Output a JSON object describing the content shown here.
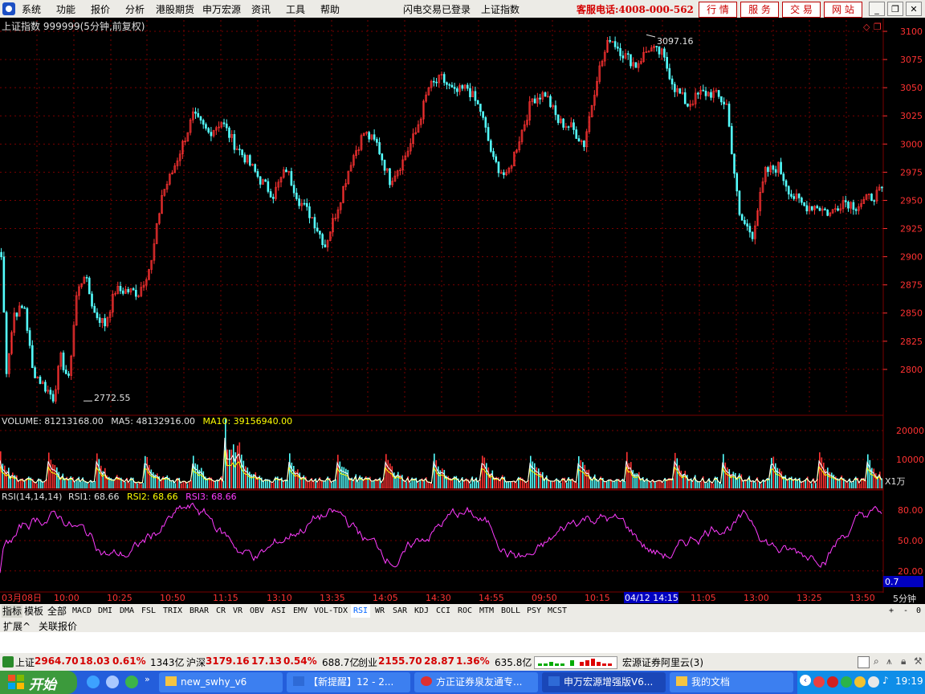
{
  "menu": {
    "items": [
      "系统",
      "功能",
      "报价",
      "分析",
      "港股期货",
      "申万宏源",
      "资讯",
      "工具",
      "帮助"
    ],
    "status_text": "闪电交易已登录",
    "index_name": "上证指数",
    "hotline": "客服电话:4008-000-562",
    "buttons": [
      "行 情",
      "服 务",
      "交 易",
      "网 站"
    ]
  },
  "chart_data": [
    {
      "type": "candlestick",
      "title": "上证指数 999999(5分钟,前复权)",
      "ylim": [
        2760,
        3110
      ],
      "yticks": [
        2800,
        2825,
        2850,
        2875,
        2900,
        2925,
        2950,
        2975,
        3000,
        3025,
        3050,
        3075,
        3100
      ],
      "keypoints": [
        [
          0,
          2900
        ],
        [
          2,
          2800
        ],
        [
          5,
          2850
        ],
        [
          9,
          2855
        ],
        [
          12,
          2800
        ],
        [
          15,
          2790
        ],
        [
          20,
          2775
        ],
        [
          23,
          2810
        ],
        [
          26,
          2790
        ],
        [
          29,
          2865
        ],
        [
          32,
          2885
        ],
        [
          36,
          2850
        ],
        [
          40,
          2840
        ],
        [
          44,
          2870
        ],
        [
          48,
          2870
        ],
        [
          53,
          2868
        ],
        [
          58,
          2895
        ],
        [
          62,
          2955
        ],
        [
          66,
          2975
        ],
        [
          70,
          3000
        ],
        [
          74,
          3025
        ],
        [
          80,
          3010
        ],
        [
          85,
          3020
        ],
        [
          90,
          3000
        ],
        [
          95,
          2985
        ],
        [
          100,
          2968
        ],
        [
          105,
          2955
        ],
        [
          110,
          2978
        ],
        [
          115,
          2950
        ],
        [
          120,
          2935
        ],
        [
          125,
          2910
        ],
        [
          130,
          2945
        ],
        [
          135,
          2985
        ],
        [
          140,
          3010
        ],
        [
          145,
          3000
        ],
        [
          150,
          2968
        ],
        [
          155,
          2985
        ],
        [
          160,
          3010
        ],
        [
          165,
          3050
        ],
        [
          170,
          3058
        ],
        [
          175,
          3045
        ],
        [
          180,
          3050
        ],
        [
          185,
          3030
        ],
        [
          190,
          2985
        ],
        [
          195,
          2970
        ],
        [
          200,
          3005
        ],
        [
          205,
          3040
        ],
        [
          210,
          3045
        ],
        [
          215,
          3020
        ],
        [
          220,
          3015
        ],
        [
          225,
          3000
        ],
        [
          230,
          3060
        ],
        [
          235,
          3095
        ],
        [
          240,
          3080
        ],
        [
          245,
          3070
        ],
        [
          250,
          3085
        ],
        [
          255,
          3080
        ],
        [
          260,
          3050
        ],
        [
          265,
          3035
        ],
        [
          270,
          3045
        ],
        [
          275,
          3045
        ],
        [
          280,
          3035
        ],
        [
          285,
          2935
        ],
        [
          290,
          2920
        ],
        [
          295,
          2975
        ],
        [
          300,
          2980
        ],
        [
          305,
          2955
        ],
        [
          310,
          2945
        ],
        [
          315,
          2945
        ],
        [
          320,
          2938
        ],
        [
          325,
          2950
        ],
        [
          330,
          2945
        ],
        [
          335,
          2952
        ],
        [
          340,
          2958
        ]
      ],
      "high_label": "3097.16",
      "low_label": "2772.55"
    },
    {
      "type": "bar",
      "title": "VOLUME",
      "values": {
        "volume": "81213168.00",
        "ma5": "48132916.00",
        "ma10": "39156940.00"
      },
      "labels": {
        "volume": "VOLUME: ",
        "ma5": "MA5: ",
        "ma10": "MA10: "
      },
      "ylim": [
        0,
        25000
      ],
      "yticks": [
        10000,
        20000
      ],
      "unit": "X1万"
    },
    {
      "type": "line",
      "title": "RSI(14,14,14)",
      "values": {
        "rsi1": "68.66",
        "rsi2": "68.66",
        "rsi3": "68.66"
      },
      "labels": {
        "rsi1": "RSI1: ",
        "rsi2": "RSI2: ",
        "rsi3": "RSI3: "
      },
      "ylim": [
        0,
        100
      ],
      "yticks": [
        20,
        50,
        80
      ],
      "current": "0.7",
      "period": "5分钟"
    }
  ],
  "time_axis": [
    "03月08日",
    "10:00",
    "10:25",
    "10:50",
    "11:15",
    "13:10",
    "13:35",
    "14:05",
    "14:30",
    "14:55",
    "09:50",
    "10:15",
    "04/12 14:15",
    "11:05",
    "13:00",
    "13:25",
    "13:50"
  ],
  "indicator_tabs": [
    "指标",
    "模板",
    "全部",
    "MACD",
    "DMI",
    "DMA",
    "FSL",
    "TRIX",
    "BRAR",
    "CR",
    "VR",
    "OBV",
    "ASI",
    "EMV",
    "VOL-TDX",
    "RSI",
    "WR",
    "SAR",
    "KDJ",
    "CCI",
    "ROC",
    "MTM",
    "BOLL",
    "PSY",
    "MCST"
  ],
  "active_tab": "RSI",
  "nav_controls": [
    "+",
    "-",
    "0"
  ],
  "sub_tabs": [
    "扩展^",
    "关联报价"
  ],
  "status": {
    "sh_label": "上证",
    "sh_price": "2964.70",
    "sh_change": "18.03",
    "sh_pct": "0.61%",
    "sh_amount": "1343亿",
    "sz_label": "沪深",
    "sz_price": "3179.16",
    "sz_change": "17.13",
    "sz_pct": "0.54%",
    "sz_amount": "688.7亿",
    "cy_label": "创业",
    "cy_price": "2155.70",
    "cy_change": "28.87",
    "cy_pct": "1.36%",
    "cy_amount": "635.8亿",
    "server": "宏源证券阿里云(3)"
  },
  "taskbar": {
    "start": "开始",
    "tasks": [
      "new_swhy_v6",
      "【新提醒】12 - 2...",
      "方正证券泉友通专...",
      "申万宏源增强版V6...",
      "我的文档"
    ],
    "clock": "19:19"
  },
  "colors": {
    "up": "#ff3232",
    "down": "#54ffff",
    "grid": "#7a0000",
    "rsi": "#ff3cff",
    "ma5": "#ffffff",
    "ma10": "#ffff00"
  }
}
